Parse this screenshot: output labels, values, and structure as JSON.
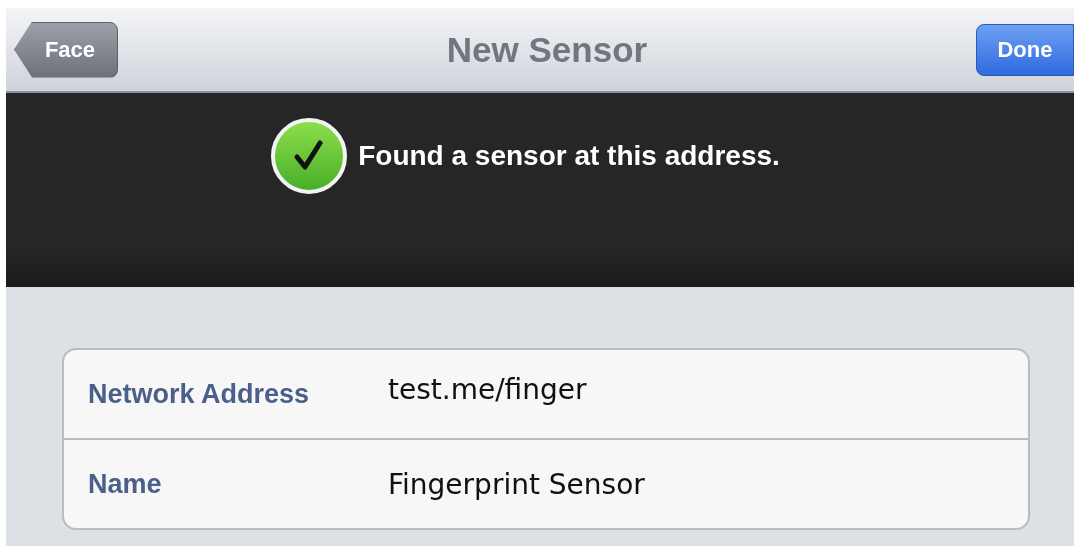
{
  "nav_bar": {
    "back_button": "Face",
    "title": "New Sensor",
    "done_button": "Done"
  },
  "banner": {
    "kind": "success",
    "message": "Found a sensor at this address."
  },
  "fields": [
    {
      "label": "Network Address",
      "value": "test.me/finger"
    },
    {
      "label": "Name",
      "value": "Fingerprint Sensor"
    }
  ]
}
